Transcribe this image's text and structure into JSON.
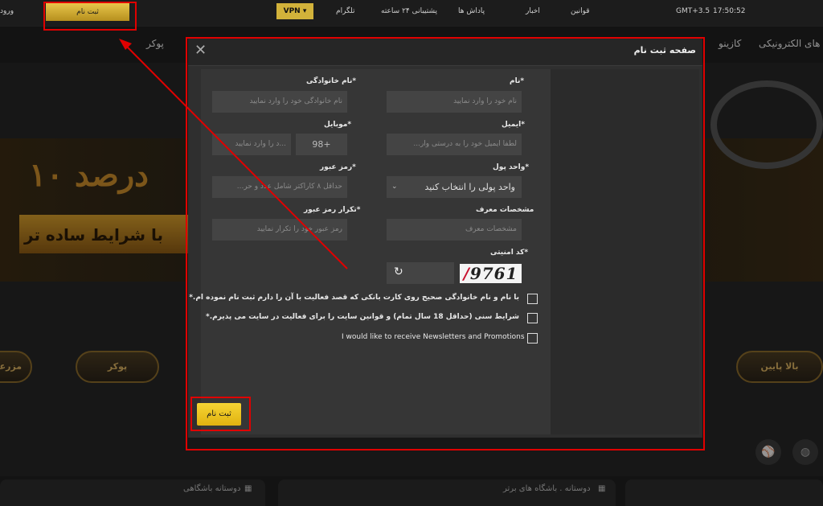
{
  "topbar": {
    "login": "ورود",
    "register": "ثبت نام",
    "vpn": "VPN ▾",
    "links": [
      "تلگرام",
      "پشتیبانی ۲۴ ساعته",
      "پاداش ها",
      "اخبار",
      "قوانین"
    ],
    "clock": "17:50:52",
    "timezone": "GMT+3.5"
  },
  "nav": {
    "items": [
      "بازی های الکترونیکی",
      "کازینو",
      "پوکر"
    ]
  },
  "banner": {
    "headline": "۱۰ درصد",
    "subline": "با شرایط ساده تر"
  },
  "games": {
    "left_partial": "مزرعه",
    "poker": "پوکر",
    "right": "بالا پایین"
  },
  "bottom": {
    "card1": "دوستانه باشگاهی",
    "card2": "دوستانه . باشگاه های برتر"
  },
  "modal": {
    "title": "صفحه ثبت نام",
    "fields": {
      "first_name_label": "نام*",
      "first_name_placeholder": "نام خود را وارد نمایید",
      "last_name_label": "نام خانوادگی*",
      "last_name_placeholder": "نام خانوادگی خود را وارد نمایید",
      "email_label": "ایمیل*",
      "email_placeholder": "لطفا ایمیل خود را به درستی وار...",
      "mobile_label": "موبایل*",
      "mobile_code": "98+",
      "mobile_placeholder": "...د را وارد نمایید",
      "currency_label": "واحد پول*",
      "currency_value": "واحد پولی را انتخاب کنید",
      "password_label": "رمز عبور*",
      "password_placeholder": "حداقل ۸ کاراکتر شامل عدد و حر...",
      "referrer_label": "مشخصات معرف",
      "referrer_placeholder": "مشخصات معرف",
      "confirm_label": "تکرار رمز عبور*",
      "confirm_placeholder": "رمز عبور خود را تکرار نمایید",
      "captcha_label": "کد امنیتی*",
      "captcha_text": "9761"
    },
    "checkboxes": [
      "با نام و نام خانوادگی صحیح روی کارت بانکی که قصد فعالیت با آن را دارم ثبت نام نموده ام.*",
      "شرایط سنی (حداقل 18 سال تمام) و قوانین سایت را برای فعالیت در سایت می پذیرم.*",
      "I would like to receive Newsletters and Promotions"
    ],
    "submit": "ثبت نام"
  },
  "colors": {
    "accent": "#f6d534",
    "annotation": "#e00000"
  }
}
